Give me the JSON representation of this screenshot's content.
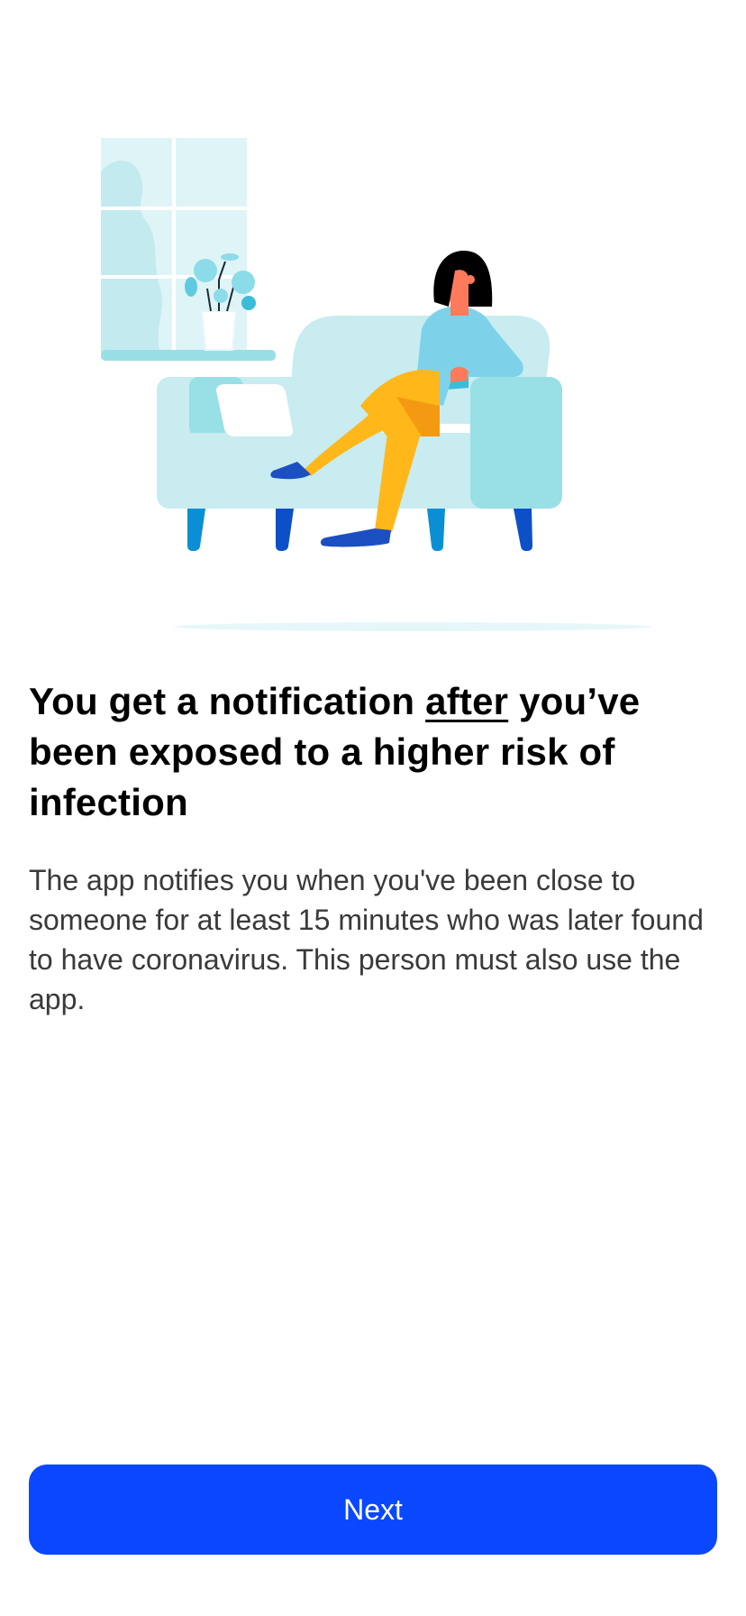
{
  "illustration": {
    "description_icon": "person-on-sofa-illustration",
    "colors": {
      "sofa_light": "#c8ecf0",
      "sofa_dark": "#98dfe6",
      "sofa_legs": "#0a8fd4",
      "sofa_legs_dark": "#0d4fc7",
      "pants": "#ffb71a",
      "pants_shadow": "#f39a12",
      "shirt": "#7dd2ea",
      "skin": "#fd7b5a",
      "hair": "#000000",
      "socks": "#1c4fc2",
      "window": "#dff4f7",
      "window_frame": "#ffffff",
      "plant": "#5fcbe0",
      "floor": "#e6f7fa"
    }
  },
  "content": {
    "title_before": "You get a notification ",
    "title_emphasis": "after",
    "title_after": " you’ve been exposed to a higher risk of infection",
    "body": "The app notifies you when you've been close to someone for at least 15 minutes who was later found to have coronavirus. This person must also use the app."
  },
  "actions": {
    "next_label": "Next"
  },
  "theme": {
    "accent": "#0a48ff",
    "title_color": "#000000",
    "body_color": "#3a3a3c",
    "background": "#ffffff"
  }
}
